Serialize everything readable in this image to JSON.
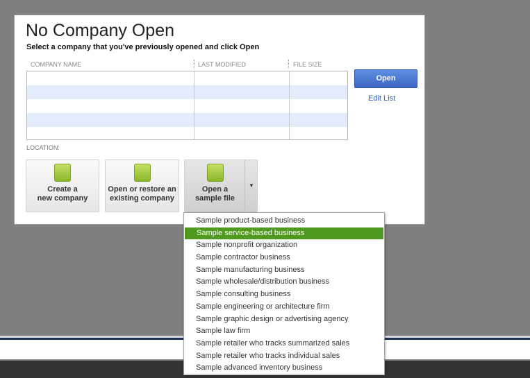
{
  "dialog": {
    "title": "No Company Open",
    "subtitle": "Select a company that you've previously opened and click Open",
    "columns": [
      "COMPANY NAME",
      "LAST MODIFIED",
      "FILE SIZE"
    ],
    "open_label": "Open",
    "edit_list_label": "Edit List",
    "location_label": "LOCATION:",
    "actions": [
      {
        "line1": "Create a",
        "line2": "new company"
      },
      {
        "line1": "Open or restore an",
        "line2": "existing company"
      },
      {
        "line1": "Open a",
        "line2": "sample file"
      }
    ]
  },
  "menu": {
    "selected_index": 1,
    "items": [
      "Sample product-based business",
      "Sample service-based business",
      "Sample nonprofit organization",
      "Sample contractor business",
      "Sample manufacturing business",
      "Sample wholesale/distribution business",
      "Sample consulting business",
      "Sample engineering or architecture firm",
      "Sample graphic design or advertising agency",
      "Sample law firm",
      "Sample retailer who tracks summarized sales",
      "Sample retailer who tracks individual sales",
      "Sample advanced inventory business"
    ]
  },
  "colors": {
    "accent": "#4f9a1e",
    "button": "#3c67c4"
  }
}
